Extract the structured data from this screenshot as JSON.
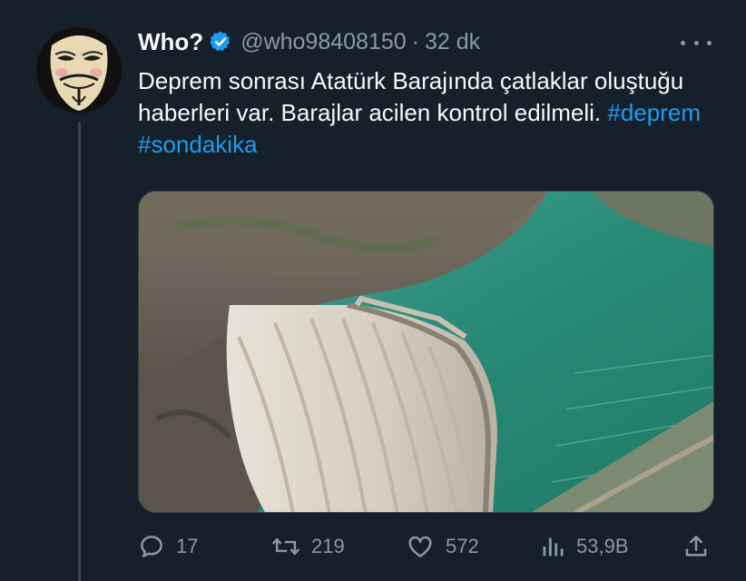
{
  "tweet": {
    "display_name": "Who?",
    "handle": "@who98408150",
    "separator": "·",
    "time": "32 dk",
    "text_before": "Deprem sonrası Atatürk Barajında çatlaklar oluştuğu haberleri var. Barajlar acilen kontrol edilmeli.",
    "hashtags": [
      "#deprem",
      "#sondakika"
    ]
  },
  "actions": {
    "replies": "17",
    "retweets": "219",
    "likes": "572",
    "views": "53,9B"
  },
  "icons": {
    "verified": "verified-badge-icon",
    "more": "more-options-icon",
    "reply": "reply-icon",
    "retweet": "retweet-icon",
    "like": "heart-icon",
    "views": "analytics-icon",
    "share": "share-icon"
  },
  "colors": {
    "background": "#15202b",
    "text": "#f7f9f9",
    "muted": "#8b98a5",
    "accent": "#1d9bf0"
  }
}
